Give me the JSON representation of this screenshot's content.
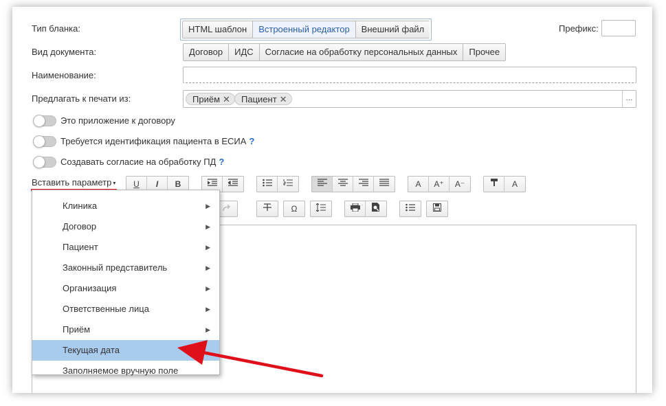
{
  "form": {
    "blank_type_label": "Тип бланка:",
    "blank_type_options": [
      "HTML шаблон",
      "Встроенный редактор",
      "Внешний файл"
    ],
    "prefix_label": "Префикс:",
    "doc_kind_label": "Вид документа:",
    "doc_kind_options": [
      "Договор",
      "ИДС",
      "Согласие на обработку персональных данных",
      "Прочее"
    ],
    "name_label": "Наименование:",
    "print_from_label": "Предлагать к печати из:",
    "print_from_tags": [
      "Приём",
      "Пациент"
    ],
    "more_button": "...",
    "tag_remove": "✕"
  },
  "toggles": [
    {
      "label": "Это приложение к договору",
      "help": ""
    },
    {
      "label": "Требуется идентификация пациента в ЕСИА",
      "help": "?"
    },
    {
      "label": "Создавать согласие на обработку ПД",
      "help": "?"
    }
  ],
  "toolbar": {
    "insert_param": "Вставить параметр",
    "caret": "▾",
    "underline": "U",
    "italic": "I",
    "bold": "B",
    "font_a": "A",
    "font_a_plus": "A⁺",
    "font_a_minus": "A⁻",
    "text_color": "A",
    "omega": "Ω"
  },
  "menu": {
    "items": [
      {
        "label": "Клиника",
        "arrow": "▶"
      },
      {
        "label": "Договор",
        "arrow": "▶"
      },
      {
        "label": "Пациент",
        "arrow": "▶"
      },
      {
        "label": "Законный представитель",
        "arrow": "▶"
      },
      {
        "label": "Организация",
        "arrow": "▶"
      },
      {
        "label": "Ответственные лица",
        "arrow": "▶"
      },
      {
        "label": "Приём",
        "arrow": "▶"
      },
      {
        "label": "Текущая дата",
        "arrow": ""
      },
      {
        "label": "Заполняемое вручную поле",
        "arrow": ""
      }
    ],
    "highlighted_index": 7
  },
  "colors": {
    "accent": "#2b5fa8",
    "highlight": "#a9cbee",
    "annotation": "#e0101a"
  }
}
